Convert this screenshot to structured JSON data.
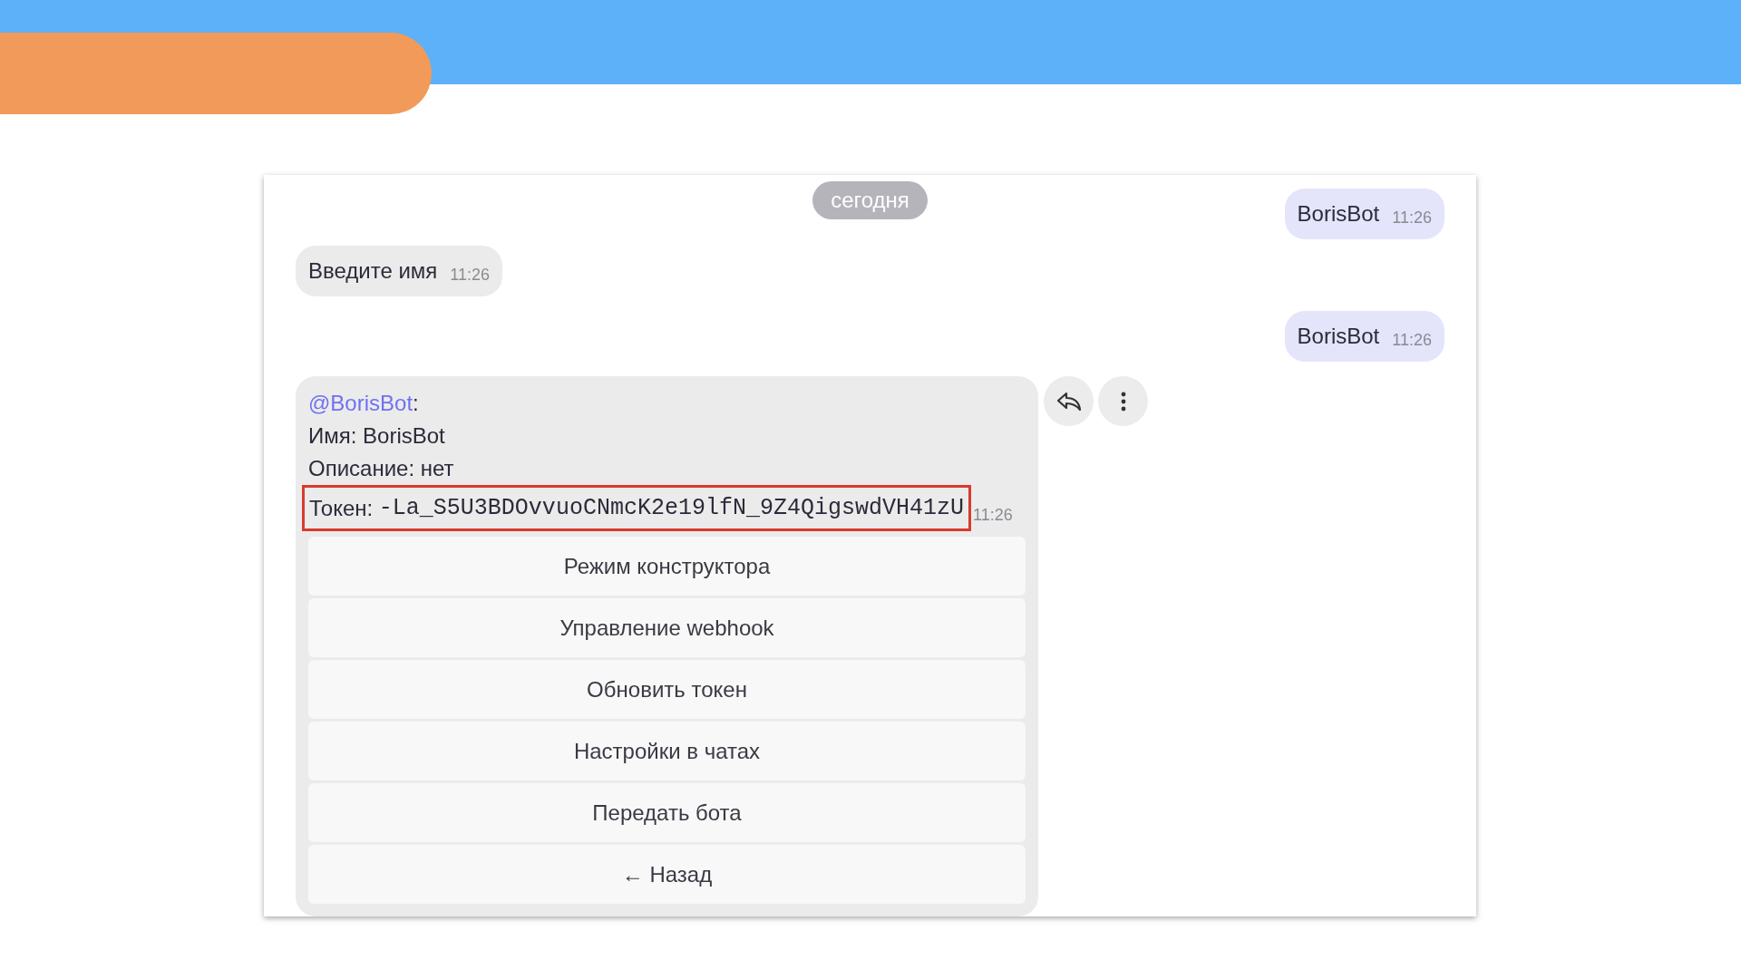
{
  "date_divider": "сегодня",
  "messages": [
    {
      "kind": "outgoing",
      "text": "BorisBot",
      "time": "11:26"
    },
    {
      "kind": "incoming",
      "text": "Введите имя",
      "time": "11:26"
    },
    {
      "kind": "outgoing",
      "text": "BorisBot",
      "time": "11:26"
    }
  ],
  "bot_message": {
    "mention": "@BorisBot",
    "mention_suffix": ":",
    "lines": [
      "Имя: BorisBot",
      "Описание: нет"
    ],
    "token_label": "Токен:",
    "token": "-La_S5U3BDOvvuoCNmcK2e19lfN_9Z4QigswdVH41zU",
    "token_highlighted": true,
    "time": "11:26",
    "buttons": [
      "Режим конструктора",
      "Управление webhook",
      "Обновить токен",
      "Настройки в чатах",
      "Передать бота",
      "← Назад"
    ]
  }
}
